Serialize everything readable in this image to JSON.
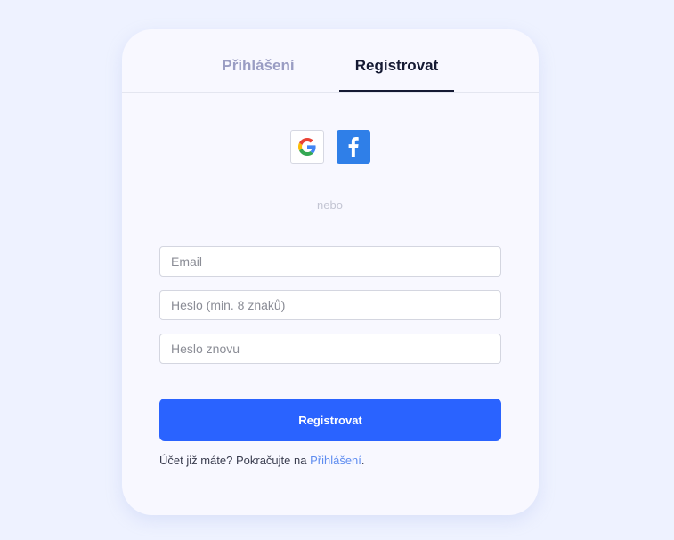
{
  "tabs": {
    "login_label": "Přihlášení",
    "register_label": "Registrovat",
    "active": "register"
  },
  "social": {
    "google_icon": "google-g-icon",
    "facebook_icon": "facebook-f-icon",
    "facebook_color": "#2f7fe8"
  },
  "divider": {
    "label": "nebo"
  },
  "form": {
    "email_placeholder": "Email",
    "email_value": "",
    "password_placeholder": "Heslo (min. 8 znaků)",
    "password_value": "",
    "password_repeat_placeholder": "Heslo znovu",
    "password_repeat_value": "",
    "submit_label": "Registrovat"
  },
  "footer": {
    "prefix": "Účet již máte? Pokračujte na ",
    "link_label": "Přihlášení",
    "suffix": "."
  },
  "colors": {
    "accent": "#2a63ff",
    "link": "#5f8df0",
    "background": "#eef2ff"
  }
}
